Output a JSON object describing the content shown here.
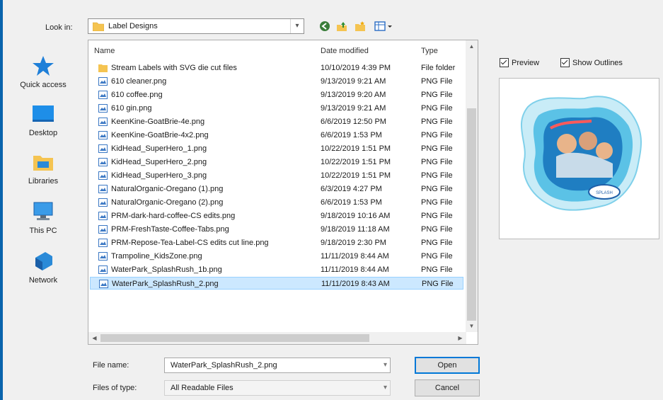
{
  "lookin": {
    "label": "Look in:",
    "value": "Label Designs"
  },
  "places": [
    {
      "label": "Quick access",
      "icon": "star-icon"
    },
    {
      "label": "Desktop",
      "icon": "desktop-icon"
    },
    {
      "label": "Libraries",
      "icon": "libraries-icon"
    },
    {
      "label": "This PC",
      "icon": "computer-icon"
    },
    {
      "label": "Network",
      "icon": "network-icon"
    }
  ],
  "columns": {
    "name": "Name",
    "date": "Date modified",
    "type": "Type"
  },
  "files": [
    {
      "name": "Stream Labels with SVG die cut files",
      "date": "10/10/2019 4:39 PM",
      "type": "File folder",
      "kind": "folder"
    },
    {
      "name": "610 cleaner.png",
      "date": "9/13/2019 9:21 AM",
      "type": "PNG File",
      "kind": "png"
    },
    {
      "name": "610 coffee.png",
      "date": "9/13/2019 9:20 AM",
      "type": "PNG File",
      "kind": "png"
    },
    {
      "name": "610 gin.png",
      "date": "9/13/2019 9:21 AM",
      "type": "PNG File",
      "kind": "png"
    },
    {
      "name": "KeenKine-GoatBrie-4e.png",
      "date": "6/6/2019 12:50 PM",
      "type": "PNG File",
      "kind": "png"
    },
    {
      "name": "KeenKine-GoatBrie-4x2.png",
      "date": "6/6/2019 1:53 PM",
      "type": "PNG File",
      "kind": "png"
    },
    {
      "name": "KidHead_SuperHero_1.png",
      "date": "10/22/2019 1:51 PM",
      "type": "PNG File",
      "kind": "png"
    },
    {
      "name": "KidHead_SuperHero_2.png",
      "date": "10/22/2019 1:51 PM",
      "type": "PNG File",
      "kind": "png"
    },
    {
      "name": "KidHead_SuperHero_3.png",
      "date": "10/22/2019 1:51 PM",
      "type": "PNG File",
      "kind": "png"
    },
    {
      "name": "NaturalOrganic-Oregano (1).png",
      "date": "6/3/2019 4:27 PM",
      "type": "PNG File",
      "kind": "png"
    },
    {
      "name": "NaturalOrganic-Oregano (2).png",
      "date": "6/6/2019 1:53 PM",
      "type": "PNG File",
      "kind": "png"
    },
    {
      "name": "PRM-dark-hard-coffee-CS edits.png",
      "date": "9/18/2019 10:16 AM",
      "type": "PNG File",
      "kind": "png"
    },
    {
      "name": "PRM-FreshTaste-Coffee-Tabs.png",
      "date": "9/18/2019 11:18 AM",
      "type": "PNG File",
      "kind": "png"
    },
    {
      "name": "PRM-Repose-Tea-Label-CS edits cut line.png",
      "date": "9/18/2019 2:30 PM",
      "type": "PNG File",
      "kind": "png"
    },
    {
      "name": "Trampoline_KidsZone.png",
      "date": "11/11/2019 8:44 AM",
      "type": "PNG File",
      "kind": "png"
    },
    {
      "name": "WaterPark_SplashRush_1b.png",
      "date": "11/11/2019 8:44 AM",
      "type": "PNG File",
      "kind": "png"
    },
    {
      "name": "WaterPark_SplashRush_2.png",
      "date": "11/11/2019 8:43 AM",
      "type": "PNG File",
      "kind": "png",
      "selected": true
    }
  ],
  "options": {
    "preview": "Preview",
    "outlines": "Show Outlines"
  },
  "filename": {
    "label": "File name:",
    "value": "WaterPark_SplashRush_2.png"
  },
  "filetype": {
    "label": "Files of type:",
    "value": "All Readable Files"
  },
  "buttons": {
    "open": "Open",
    "cancel": "Cancel"
  },
  "colors": {
    "selection": "#cce8ff",
    "accent": "#0078d7",
    "folder": "#f5c451",
    "png": "#3b78c4"
  }
}
